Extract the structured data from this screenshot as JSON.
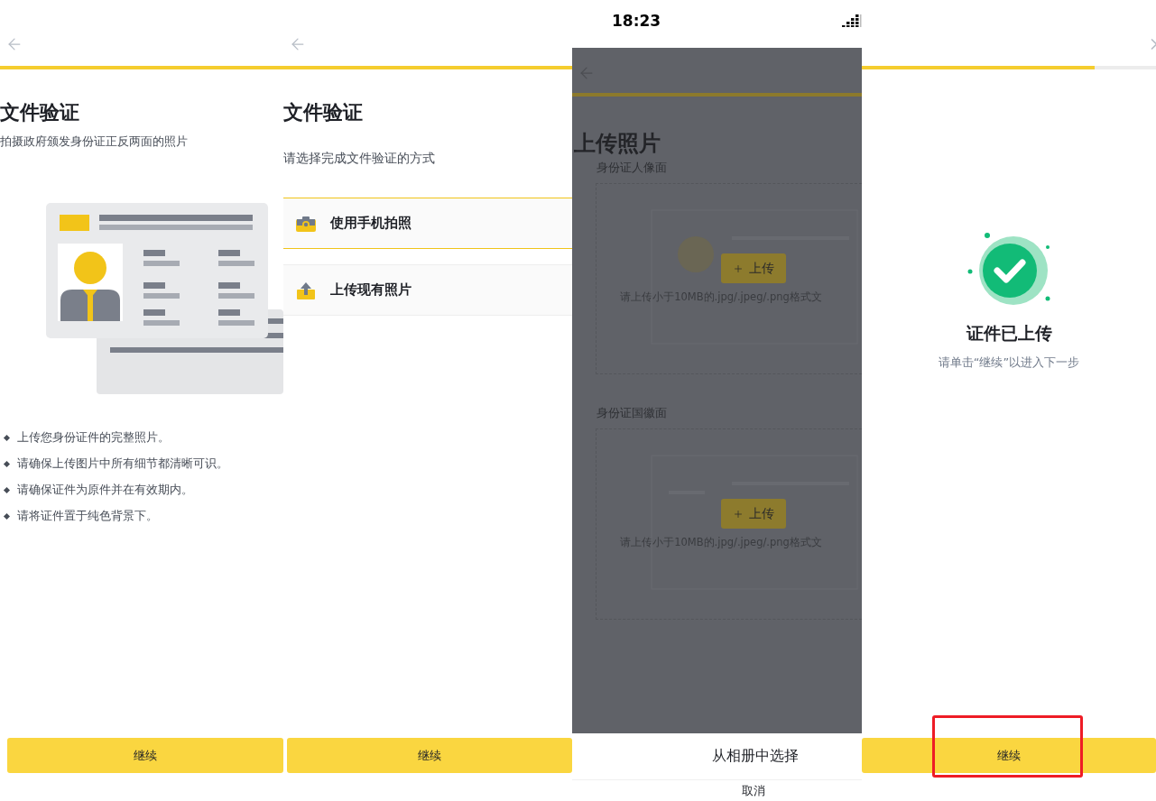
{
  "screens": [
    {
      "kind": "intro",
      "level": 1,
      "title": "文件验证",
      "subtitle": "拍摄政府颁发身份证正反两面的照片",
      "bullets": [
        "上传您身份证件的完整照片。",
        "请确保上传图片中所有细节都清晰可识。",
        "请确保证件为原件并在有效期内。",
        "请将证件置于纯色背景下。"
      ],
      "button": {
        "label": "继续",
        "highlighted": false
      }
    },
    {
      "kind": "method",
      "level": 1,
      "title": "文件验证",
      "subtitle": "请选择完成文件验证的方式",
      "options": [
        {
          "kind": "camera",
          "label": "使用手机拍照",
          "selected": true
        },
        {
          "kind": "upload",
          "label": "上传现有照片",
          "selected": false
        }
      ],
      "button": {
        "label": "继续",
        "highlighted": false
      }
    },
    {
      "kind": "upload",
      "status_bar": {
        "time": "18:23"
      },
      "level": 1,
      "title": "上传照片",
      "sections": [
        {
          "kind": "portrait",
          "label": "身份证人像面",
          "button": "上传",
          "hint": "请上传小于10MB的.jpg/.jpeg/.png格式文"
        },
        {
          "kind": "emblem",
          "label": "身份证国徽面",
          "button": "上传",
          "hint": "请上传小于10MB的.jpg/.jpeg/.png格式文"
        }
      ],
      "sheet": {
        "options": [
          "从相册中选择"
        ],
        "cancel": "取消"
      }
    },
    {
      "kind": "done",
      "level": 0.79,
      "title": "证件已上传",
      "subtitle": "请单击“继续”以进入下一步",
      "button": {
        "label": "继续",
        "highlighted": true
      }
    }
  ]
}
